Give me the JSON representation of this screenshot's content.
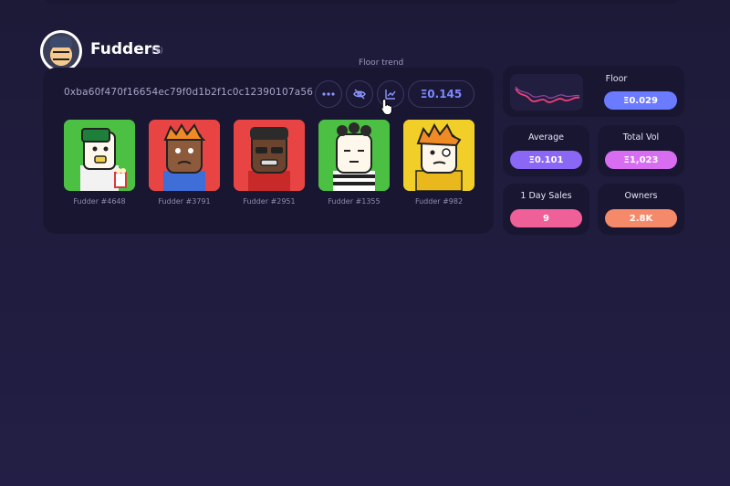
{
  "collection": {
    "name": "Fudders",
    "count": "(5)",
    "address": "0xba60f470f16654ec79f0d1b2f1c0c12390107a56"
  },
  "toolbar": {
    "tooltip": "Floor trend",
    "price": "Ξ0.145",
    "more_icon": "more-horizontal-icon",
    "hide_icon": "eye-off-icon",
    "chart_icon": "trend-chart-icon"
  },
  "nfts": [
    {
      "label": "Fudder #4648",
      "bg": "#4cc043"
    },
    {
      "label": "Fudder #3791",
      "bg": "#e84444"
    },
    {
      "label": "Fudder #2951",
      "bg": "#e84444"
    },
    {
      "label": "Fudder #1355",
      "bg": "#4cc043"
    },
    {
      "label": "Fudder #982",
      "bg": "#f2cf28"
    }
  ],
  "stats": {
    "floor": {
      "label": "Floor",
      "value": "Ξ0.029",
      "color": "#6b7bff"
    },
    "average": {
      "label": "Average",
      "value": "Ξ0.101",
      "color": "#8a67f5"
    },
    "total_vol": {
      "label": "Total Vol",
      "value": "Ξ1,023",
      "color": "#d86df2"
    },
    "day_sales": {
      "label": "1 Day Sales",
      "value": "9",
      "color": "#ef5f98"
    },
    "owners": {
      "label": "Owners",
      "value": "2.8K",
      "color": "#f48a6a"
    }
  },
  "colors": {
    "background": "#1f1b40",
    "card": "#191631",
    "accent": "#7d88ff",
    "sparkline": "#ef3f7a"
  }
}
